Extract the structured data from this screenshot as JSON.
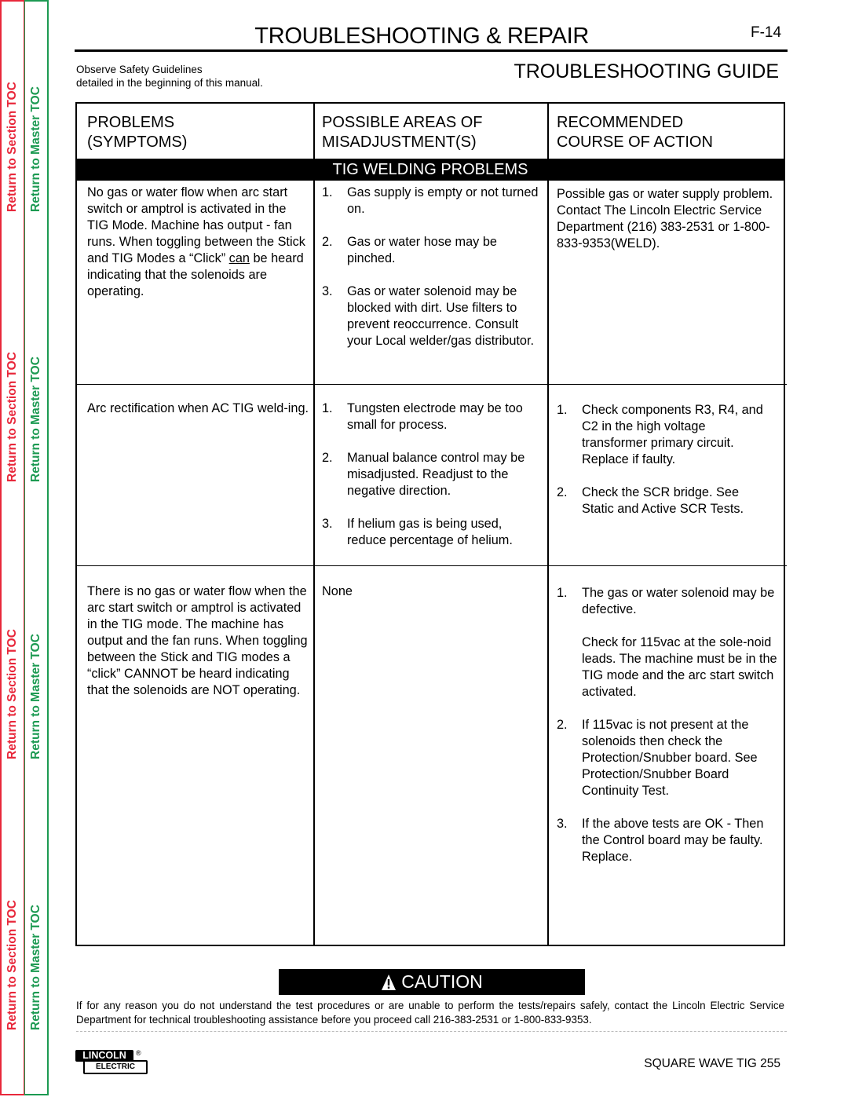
{
  "sidebar": {
    "section_toc_label": "Return to Section TOC",
    "master_toc_label": "Return to Master TOC",
    "colors": {
      "section": "#e8283b",
      "master": "#1c9a52"
    }
  },
  "header": {
    "title": "TROUBLESHOOTING & REPAIR",
    "page_number": "F-14",
    "safety_line1": "Observe Safety Guidelines",
    "safety_line2": "detailed in the beginning of this manual.",
    "guide_title": "TROUBLESHOOTING GUIDE"
  },
  "table": {
    "headers": [
      {
        "line1": "PROBLEMS",
        "line2": "(SYMPTOMS)"
      },
      {
        "line1": "POSSIBLE AREAS OF",
        "line2": "MISADJUSTMENT(S)"
      },
      {
        "line1": "RECOMMENDED",
        "line2": "COURSE OF ACTION"
      }
    ],
    "section_banner": "TIG WELDING PROBLEMS",
    "rows": [
      {
        "problem": {
          "text_before": "No gas or water flow when arc start switch or amptrol is activated in the TIG Mode.  Machine has output - fan runs.  When toggling between the Stick and TIG Modes a “Click” ",
          "underlined": "can",
          "text_after": " be heard indicating that the solenoids are operating."
        },
        "causes": [
          {
            "num": "1.",
            "text": "Gas supply is empty or not turned on."
          },
          {
            "num": "2.",
            "text": "Gas or water hose may be pinched."
          },
          {
            "num": "3.",
            "text": "Gas or water solenoid may be blocked with dirt.  Use filters to prevent reoccurrence. Consult your Local welder/gas distributor."
          }
        ],
        "actions": {
          "para1": "Possible gas or water supply problem.",
          "para2": "Contact The Lincoln Electric Service Department (216) 383-2531 or 1-800-833-9353(WELD)."
        }
      },
      {
        "problem": {
          "text": "Arc rectification when AC TIG weld-ing."
        },
        "causes": [
          {
            "num": "1.",
            "text": "Tungsten electrode may be too small for process."
          },
          {
            "num": "2.",
            "text": "Manual balance control may be misadjusted.  Readjust to the negative direction."
          },
          {
            "num": "3.",
            "text": "If helium gas is being used, reduce percentage of helium."
          }
        ],
        "actions": [
          {
            "num": "1.",
            "text": "Check components R3, R4, and C2 in the high voltage transformer primary circuit. Replace if faulty."
          },
          {
            "num": "2.",
            "text": "Check the SCR bridge.  See Static and Active SCR Tests."
          }
        ]
      },
      {
        "problem": {
          "text": "There is no gas or water flow when the arc start switch or amptrol is activated in the TIG mode.  The machine has output and the fan runs.  When toggling between the Stick and TIG modes a “click” CANNOT be heard indicating that the solenoids are NOT operating."
        },
        "causes": [
          {
            "text": "None"
          }
        ],
        "actions": [
          {
            "num": "1.",
            "text": "The gas or water solenoid may be defective.",
            "sub": "Check for 115vac at the sole-noid leads. The machine must be in the TIG mode and the arc start switch activated."
          },
          {
            "num": "2.",
            "text": "If 115vac is not present at the solenoids then check the Protection/Snubber board.  See Protection/Snubber Board Continuity Test."
          },
          {
            "num": "3.",
            "text": "If the above tests are OK - Then the Control board may be faulty. Replace."
          }
        ]
      }
    ]
  },
  "caution": {
    "label": "CAUTION",
    "icon": "warning-triangle-icon",
    "text": "If for any reason you do not understand the test procedures or are unable to perform the tests/repairs safely, contact the Lincoln Electric Service Department for technical troubleshooting assistance before you proceed call 216-383-2531 or 1-800-833-9353."
  },
  "footer": {
    "logo_top": "LINCOLN",
    "logo_bottom": "ELECTRIC",
    "logo_reg": "®",
    "model": "SQUARE WAVE TIG 255"
  }
}
